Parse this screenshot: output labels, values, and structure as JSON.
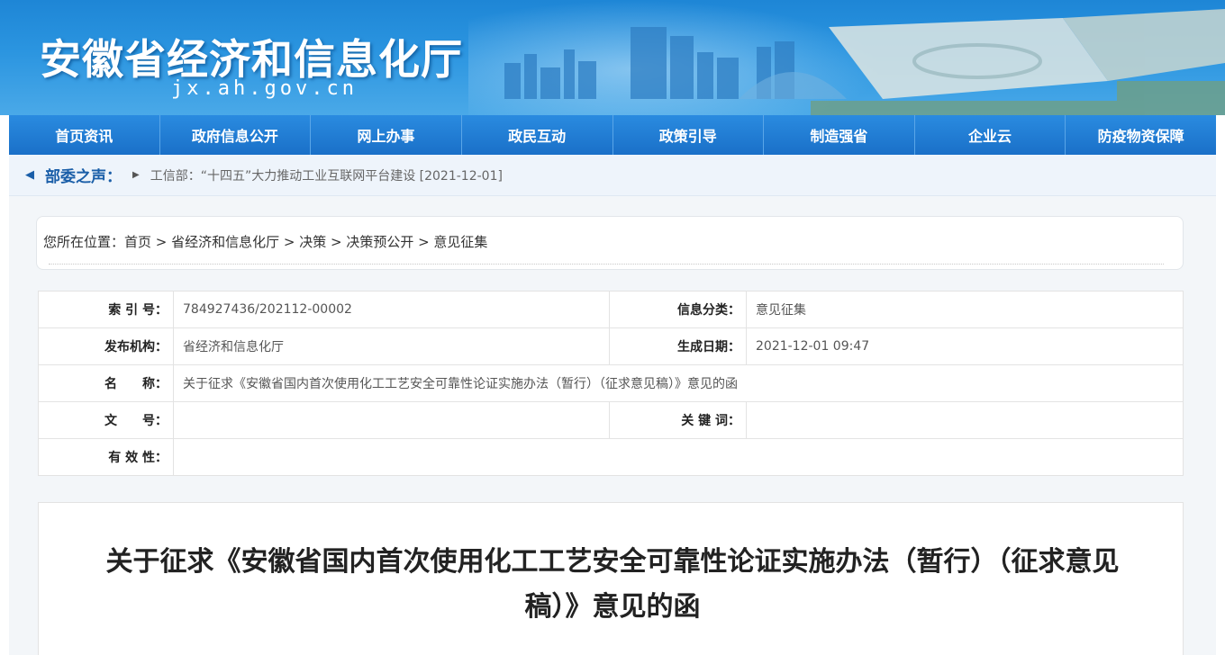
{
  "banner": {
    "title": "安徽省经济和信息化厅",
    "url": "jx.ah.gov.cn"
  },
  "nav": {
    "items": [
      {
        "label": "首页资讯"
      },
      {
        "label": "政府信息公开"
      },
      {
        "label": "网上办事"
      },
      {
        "label": "政民互动"
      },
      {
        "label": "政策引导"
      },
      {
        "label": "制造强省"
      },
      {
        "label": "企业云"
      },
      {
        "label": "防疫物资保障"
      }
    ]
  },
  "ticker": {
    "label": "部委之声：",
    "text": "工信部：“十四五”大力推动工业互联网平台建设 [2021-12-01]"
  },
  "breadcrumb": {
    "text": "您所在位置：首页 > 省经济和信息化厅 > 决策 > 决策预公开 > 意见征集"
  },
  "meta": {
    "index_label": "索 引 号：",
    "index_value": "784927436/202112-00002",
    "category_label": "信息分类：",
    "category_value": "意见征集",
    "publisher_label": "发布机构：",
    "publisher_value": "省经济和信息化厅",
    "date_label": "生成日期：",
    "date_value": "2021-12-01 09:47",
    "name_label": "名　　称：",
    "name_value": "关于征求《安徽省国内首次使用化工工艺安全可靠性论证实施办法（暂行）（征求意见稿）》意见的函",
    "docno_label": "文　　号：",
    "docno_value": "",
    "keywords_label": "关 键 词：",
    "keywords_value": "",
    "validity_label": "有 效 性：",
    "validity_value": ""
  },
  "article": {
    "title": "关于征求《安徽省国内首次使用化工工艺安全可靠性论证实施办法（暂行）（征求意见稿）》意见的函"
  }
}
